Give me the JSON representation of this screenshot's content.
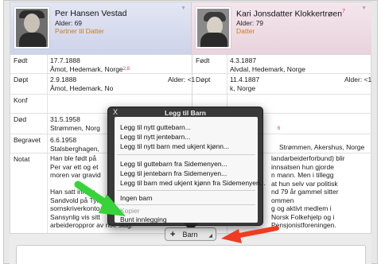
{
  "persons": {
    "left": {
      "name": "Per Hansen Vestad",
      "age": "Alder: 69",
      "role": "Partner til Datter"
    },
    "right": {
      "name": "Kari Jonsdatter Klokkertrøen",
      "name_src": "7",
      "age": "Alder: 79",
      "role": "Datter"
    }
  },
  "rows": {
    "fodt": {
      "label": "Født",
      "left_date": "17.7.1888",
      "left_place": "Åmot, Hedemark, Norge",
      "left_src": "2,8",
      "right_date": "4.3.1887",
      "right_place": "Alvdal, Hedemark, Norge"
    },
    "dopt": {
      "label": "Døpt",
      "left_date": "2.9.1888",
      "left_age": "Alder: <1",
      "left_place": "Åmot, Hedemark, No",
      "right_date": "11.4.1887",
      "right_age": "Alder: <1",
      "right_place": "k, Norge"
    },
    "konf": {
      "label": "Konf"
    },
    "dod": {
      "label": "Død",
      "left_date": "31.5.1958",
      "left_place": "Strømmen, Norg",
      "right_src": "6"
    },
    "begravet": {
      "label": "Begravet",
      "left_date": "6.6.1958",
      "left_place": "Stalsberghagen,",
      "right_place": "Strømmen, Akershus, Norge"
    },
    "notat": {
      "label": "Notat",
      "left_lines": [
        "Han ble født på",
        "Per var ett og et",
        "moren var gravid",
        "",
        "Han satt inne s",
        "Sandvold på Tyn",
        "sornskriverkonto",
        "Sansynlig vis sitt",
        "arbeideroppror av noe slag."
      ],
      "left_src": "1",
      "right_lines": [
        "landarbeiderforbund) blir",
        "innsatsen hun gjorde",
        "n mann. Men i tillegg",
        "at hun selv var politisk",
        "nd 79 år gammel sitter",
        "ommen",
        "g og aktivt medlem i",
        "Norsk Folkehjelp og i",
        "Pensjonistforeningen."
      ]
    }
  },
  "menu": {
    "title": "Legg til Barn",
    "close": "X",
    "items": [
      "Legg til nytt guttebarn...",
      "Legg til nytt jentebarn...",
      "Legg til nytt barn med ukjent kjønn...",
      "Legg til guttebarn fra Sidemenyen...",
      "Legg til jentebarn fra Sidemenyen...",
      "Legg til barn med ukjent kjønn fra Sidemenyen...",
      "Ingen barn",
      "Kopier",
      "Bunt innlegging"
    ]
  },
  "barn_button": {
    "plus": "+",
    "label": "Barn"
  },
  "colors": {
    "arrow_green": "#37d33a",
    "arrow_red": "#ee3b22",
    "role_text": "#cc7a1e",
    "source_ref": "#cc3a6a"
  }
}
